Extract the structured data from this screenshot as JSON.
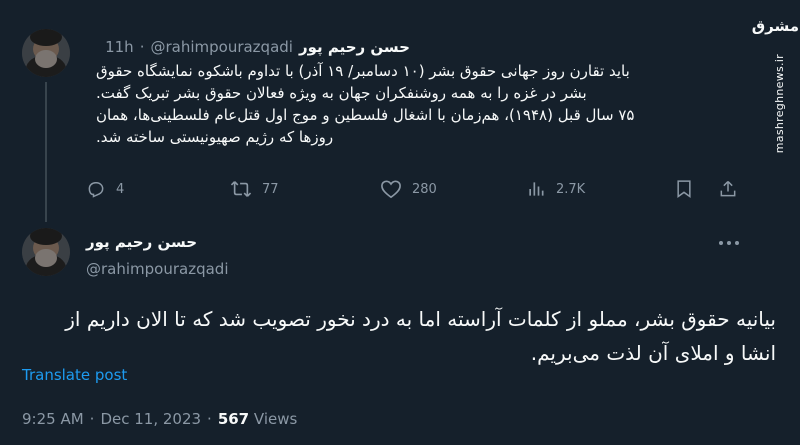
{
  "colors": {
    "background": "#15202b",
    "text_primary": "#f7f9f9",
    "text_secondary": "#8b98a5",
    "link": "#1d9bf0",
    "divider": "#38444d"
  },
  "tweet1": {
    "author_name": "حسن رحیم پور",
    "handle": "@rahimpourazqadi",
    "time": "11h",
    "body": [
      "باید تقارن روز جهانی حقوق بشر (۱۰ دسامبر/ ۱۹ آذر) با تداوم باشکوه نمایشگاه حقوق",
      "بشر در غزه را به همه روشنفکران جهان به ویژه فعالان حقوق بشر تبریک گفت.",
      "۷۵ سال قبل (۱۹۴۸)، هم‌زمان با اشغال فلسطین و موج اول قتل‌عام فلسطینی‌ها، همان",
      "روزها که رژیم صهیونیستی ساخته شد."
    ],
    "actions": {
      "reply_count": "4",
      "retweet_count": "77",
      "like_count": "280",
      "views_count": "2.7K"
    },
    "icons": {
      "reply": "reply-icon",
      "retweet": "retweet-icon",
      "like": "heart-icon",
      "views": "views-chart-icon",
      "bookmark": "bookmark-icon",
      "share": "share-icon"
    }
  },
  "tweet2": {
    "author_name": "حسن رحیم پور",
    "handle": "@rahimpourazqadi",
    "body": [
      "بیانیه حقوق بشر، مملو از کلمات آراسته اما به درد نخور تصویب شد که تا الان داریم از",
      "انشا و املای آن لذت می‌بریم."
    ],
    "translate_label": "Translate post",
    "footer": {
      "time": "9:25 AM",
      "date": "Dec 11, 2023",
      "views_count": "567",
      "views_label": "Views",
      "separator": "·"
    },
    "more_icon": "more-horizontal-icon"
  },
  "watermark": {
    "logo_text": "مشرق",
    "url": "mashreghnews.ir"
  }
}
